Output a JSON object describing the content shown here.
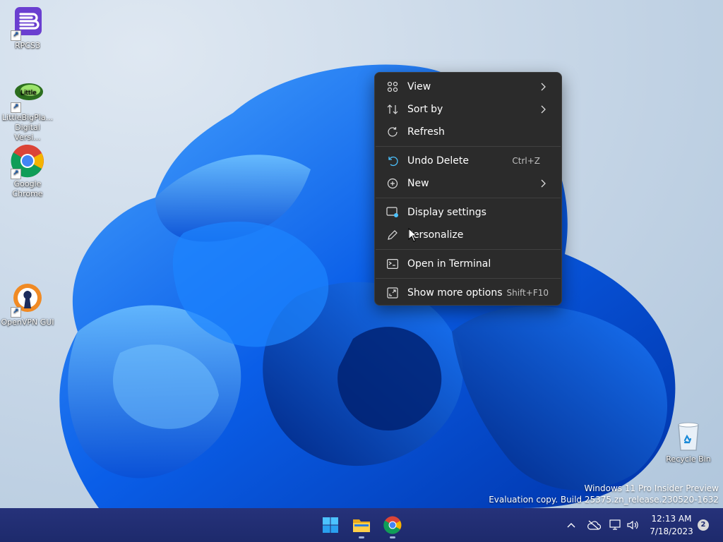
{
  "desktop": {
    "icons": [
      {
        "name": "rpcs3",
        "label": "RPCS3"
      },
      {
        "name": "littlebigplanet",
        "label": "LittleBigPla...\nDigital Versi..."
      },
      {
        "name": "google-chrome",
        "label": "Google\nChrome"
      },
      {
        "name": "openvpn-gui",
        "label": "OpenVPN GUI"
      },
      {
        "name": "recycle-bin",
        "label": "Recycle Bin"
      }
    ],
    "watermark": {
      "line1": "Windows 11 Pro Insider Preview",
      "line2": "Evaluation copy. Build 25375.zn_release.230520-1632"
    }
  },
  "context_menu": {
    "items": [
      {
        "label": "View",
        "icon": "grid-icon",
        "submenu": true
      },
      {
        "label": "Sort by",
        "icon": "sort-icon",
        "submenu": true
      },
      {
        "label": "Refresh",
        "icon": "refresh-icon"
      },
      {
        "label": "Undo Delete",
        "icon": "undo-icon",
        "shortcut": "Ctrl+Z"
      },
      {
        "label": "New",
        "icon": "plus-circle-icon",
        "submenu": true
      },
      {
        "label": "Display settings",
        "icon": "display-icon"
      },
      {
        "label": "Personalize",
        "icon": "pen-icon"
      },
      {
        "label": "Open in Terminal",
        "icon": "terminal-icon"
      },
      {
        "label": "Show more options",
        "icon": "expand-icon",
        "shortcut": "Shift+F10"
      }
    ]
  },
  "taskbar": {
    "apps": [
      "start-icon",
      "file-explorer-icon",
      "chrome-icon"
    ],
    "tray": {
      "time": "12:13 AM",
      "date": "7/18/2023",
      "notifications": "2"
    }
  },
  "colors": {
    "menu_bg": "#2b2b2b",
    "taskbar_bg": "#1f2b6f",
    "accent": "#0078d4"
  }
}
